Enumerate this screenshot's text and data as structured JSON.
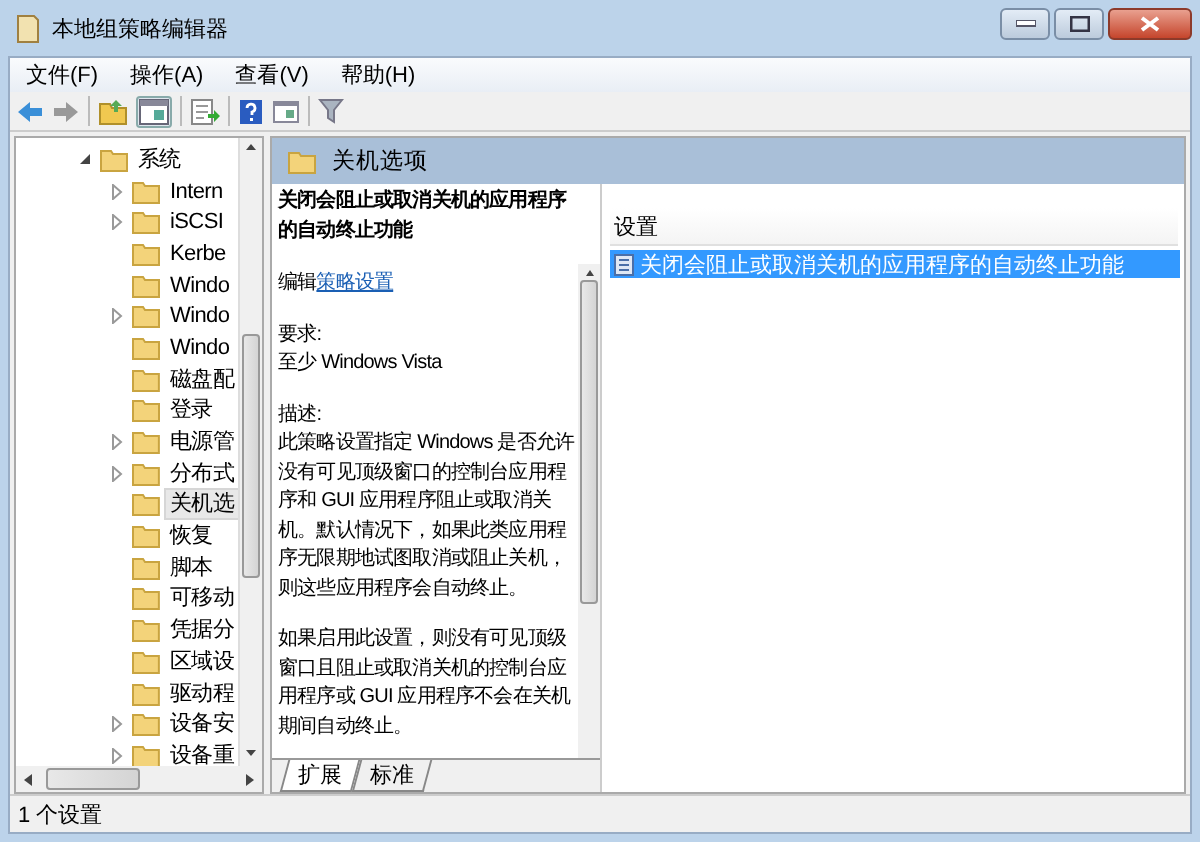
{
  "window": {
    "title": "本地组策略编辑器"
  },
  "menu": [
    "文件(F)",
    "操作(A)",
    "查看(V)",
    "帮助(H)"
  ],
  "tree": {
    "items": [
      {
        "label": "系统",
        "kind": "branch",
        "expanded": true,
        "selected": false,
        "children": [
          {
            "label": "Intern",
            "kind": "branch",
            "expanded": false,
            "selected": false
          },
          {
            "label": "iSCSI",
            "kind": "branch",
            "expanded": false,
            "selected": false
          },
          {
            "label": "Kerbe",
            "kind": "leaf",
            "selected": false
          },
          {
            "label": "Windo",
            "kind": "leaf",
            "selected": false
          },
          {
            "label": "Windo",
            "kind": "branch",
            "expanded": false,
            "selected": false
          },
          {
            "label": "Windo",
            "kind": "leaf",
            "selected": false
          },
          {
            "label": "磁盘配",
            "kind": "leaf",
            "selected": false
          },
          {
            "label": "登录",
            "kind": "leaf",
            "selected": false
          },
          {
            "label": "电源管",
            "kind": "branch",
            "expanded": false,
            "selected": false
          },
          {
            "label": "分布式",
            "kind": "branch",
            "expanded": false,
            "selected": false
          },
          {
            "label": "关机选",
            "kind": "leaf",
            "selected": true
          },
          {
            "label": "恢复",
            "kind": "leaf",
            "selected": false
          },
          {
            "label": "脚本",
            "kind": "leaf",
            "selected": false
          },
          {
            "label": "可移动",
            "kind": "leaf",
            "selected": false
          },
          {
            "label": "凭据分",
            "kind": "leaf",
            "selected": false
          },
          {
            "label": "区域设",
            "kind": "leaf",
            "selected": false
          },
          {
            "label": "驱动程",
            "kind": "leaf",
            "selected": false
          },
          {
            "label": "设备安",
            "kind": "branch",
            "expanded": false,
            "selected": false
          },
          {
            "label": "设备重",
            "kind": "branch",
            "expanded": false,
            "selected": false
          }
        ]
      }
    ]
  },
  "header": {
    "title": "关机选项"
  },
  "details": {
    "title": "关闭会阻止或取消关机的应用程序的自动终止功能",
    "edit_prefix": "编辑",
    "edit_link": "策略设置",
    "requirements_label": "要求:",
    "requirements": "至少 Windows Vista",
    "description_label": "描述:",
    "paragraphs": [
      "此策略设置指定 Windows 是否允许没有可见顶级窗口的控制台应用程序和 GUI 应用程序阻止或取消关机。默认情况下，如果此类应用程序无限期地试图取消或阻止关机，则这些应用程序会自动终止。",
      "如果启用此设置，则没有可见顶级窗口且阻止或取消关机的控制台应用程序或 GUI 应用程序不会在关机期间自动终止。"
    ]
  },
  "settings": {
    "column": "设置",
    "rows": [
      {
        "label": "关闭会阻止或取消关机的应用程序的自动终止功能",
        "selected": true
      }
    ]
  },
  "view_tabs": [
    {
      "label": "扩展",
      "selected": true
    },
    {
      "label": "标准",
      "selected": false
    }
  ],
  "status_bar": "1 个设置"
}
